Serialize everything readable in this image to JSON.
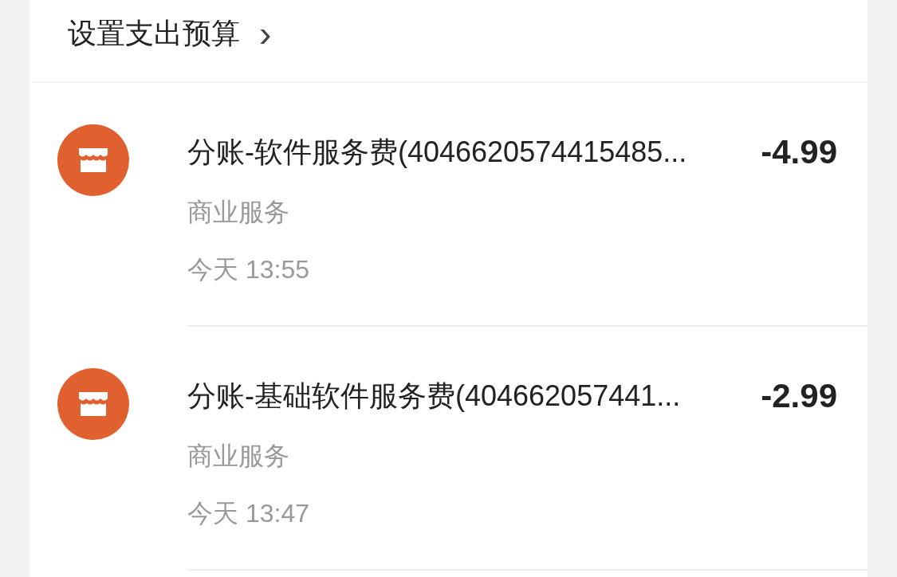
{
  "budget_link": {
    "label": "设置支出预算",
    "chevron": "›"
  },
  "transactions": [
    {
      "title": "分账-软件服务费(4046620574415485...",
      "amount": "-4.99",
      "category": "商业服务",
      "time": "今天 13:55"
    },
    {
      "title": "分账-基础软件服务费(404662057441...",
      "amount": "-2.99",
      "category": "商业服务",
      "time": "今天 13:47"
    }
  ]
}
